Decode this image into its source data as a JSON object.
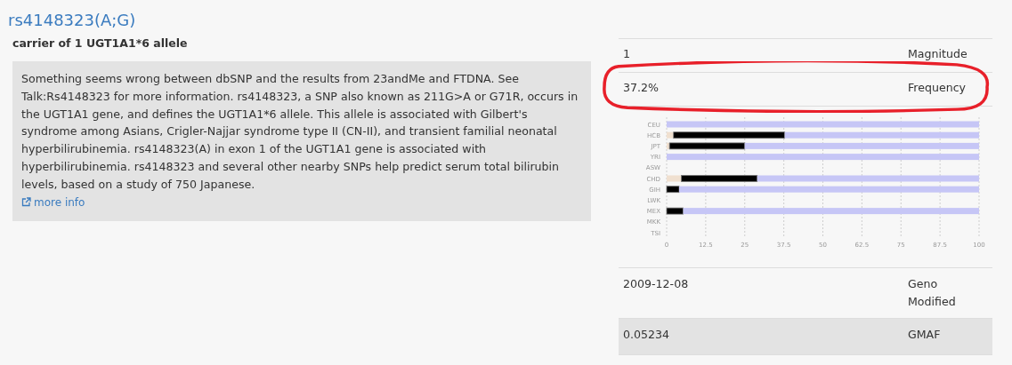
{
  "title": "rs4148323(A;G)",
  "summary": "carrier of 1 UGT1A1*6 allele",
  "description": "Something seems wrong between dbSNP and the results from 23andMe and FTDNA. See Talk:Rs4148323 for more information. rs4148323, a SNP also known as 211G>A or G71R, occurs in the UGT1A1 gene, and defines the UGT1A1*6 allele. This allele is associated with Gilbert's syndrome among Asians, Crigler-Najjar syndrome type II (CN-II), and transient familial neonatal hyperbilirubinemia. rs4148323(A) in exon 1 of the UGT1A1 gene is associated with hyperbilirubinemia. rs4148323 and several other nearby SNPs help predict serum total bilirubin levels, based on a study of 750 Japanese.",
  "more_info": "more info",
  "info_table": {
    "rows": [
      {
        "kind": "text",
        "value": "1",
        "label": "Magnitude",
        "highlighted": false,
        "shaded": false
      },
      {
        "kind": "text",
        "value": "37.2%",
        "label": "Frequency",
        "highlighted": true,
        "shaded": false
      },
      {
        "kind": "chart",
        "chart_data": {
          "type": "bar",
          "orientation": "horizontal",
          "stacked": true,
          "categories": [
            "CEU",
            "HCB",
            "JPT",
            "YRI",
            "ASW",
            "CHD",
            "GIH",
            "LWK",
            "MEX",
            "MKK",
            "TSI"
          ],
          "series": [
            {
              "color": "#f0e0d0",
              "values": [
                0,
                2.2,
                0.9,
                0,
                null,
                4.7,
                0,
                null,
                0,
                null,
                null
              ]
            },
            {
              "color": "#000000",
              "values": [
                0,
                35.6,
                24.1,
                0,
                null,
                24.3,
                4,
                null,
                5.3,
                null,
                null
              ]
            },
            {
              "color": "#c6c6f6",
              "values": [
                100,
                62.2,
                75,
                100,
                null,
                71,
                96,
                null,
                94.7,
                null,
                null
              ]
            }
          ],
          "xlim": [
            0,
            100
          ],
          "grid": true,
          "xticks": [
            0,
            12.5,
            25,
            37.5,
            50,
            62.5,
            75,
            87.5,
            100
          ]
        }
      },
      {
        "kind": "text",
        "value": "2009-12-08",
        "label": "Geno Modified",
        "highlighted": false,
        "shaded": false
      },
      {
        "kind": "text",
        "value": "0.05234",
        "label": "GMAF",
        "highlighted": false,
        "shaded": true
      }
    ]
  }
}
